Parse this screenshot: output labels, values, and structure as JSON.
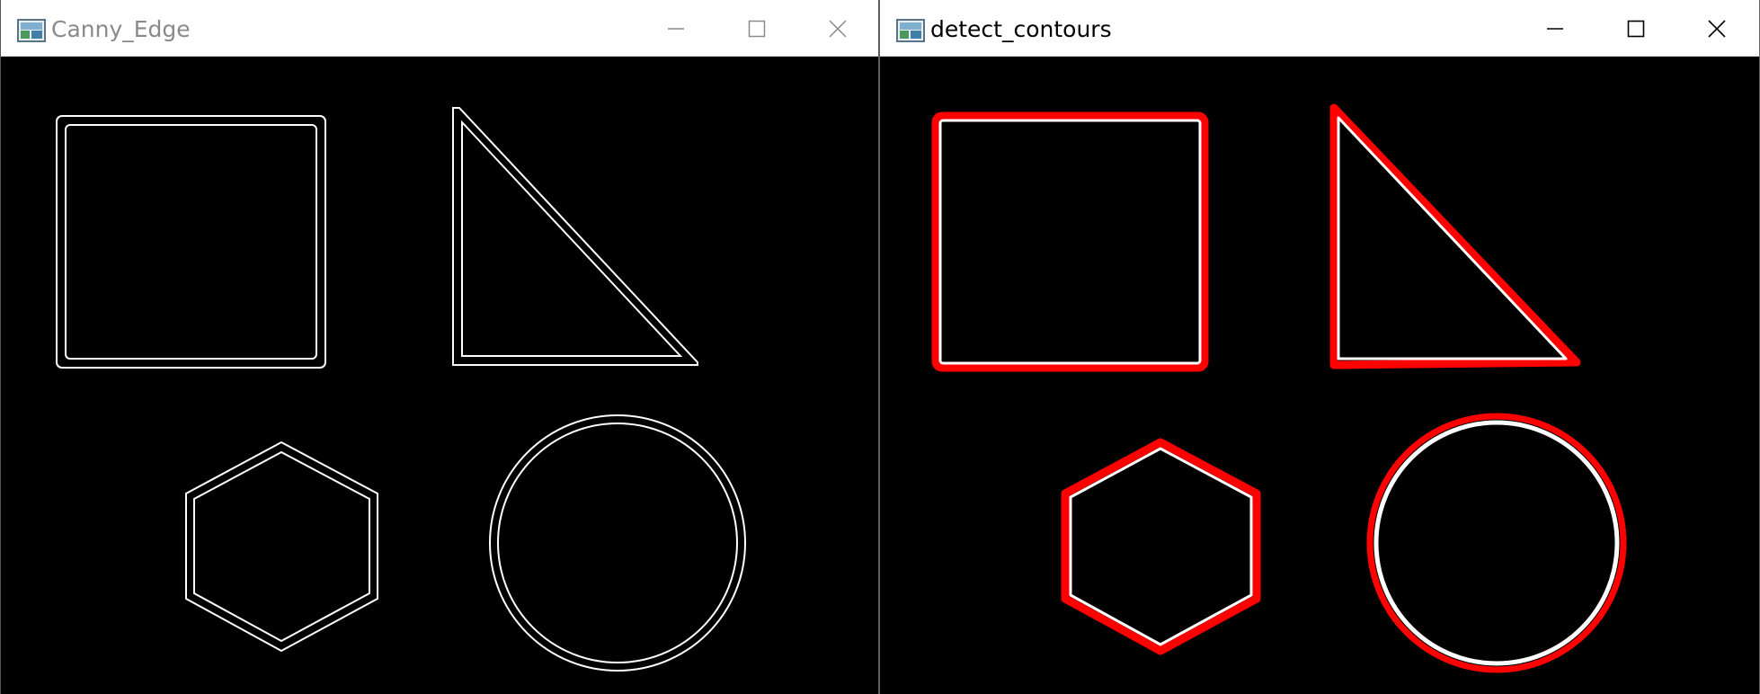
{
  "windows": {
    "left": {
      "title": "Canny_Edge",
      "icon": "app-image-icon",
      "controls": [
        "minimize-icon",
        "maximize-icon",
        "close-icon"
      ],
      "title_color": "#8a8a8a"
    },
    "right": {
      "title": "detect_contours",
      "icon": "app-image-icon",
      "controls": [
        "minimize-icon",
        "maximize-icon",
        "close-icon"
      ],
      "title_color": "#000000"
    }
  },
  "colors": {
    "canvas_bg": "#000000",
    "edge_stroke": "#ffffff",
    "contour_stroke": "#ff0000",
    "contour_fill": "#ffffff"
  }
}
